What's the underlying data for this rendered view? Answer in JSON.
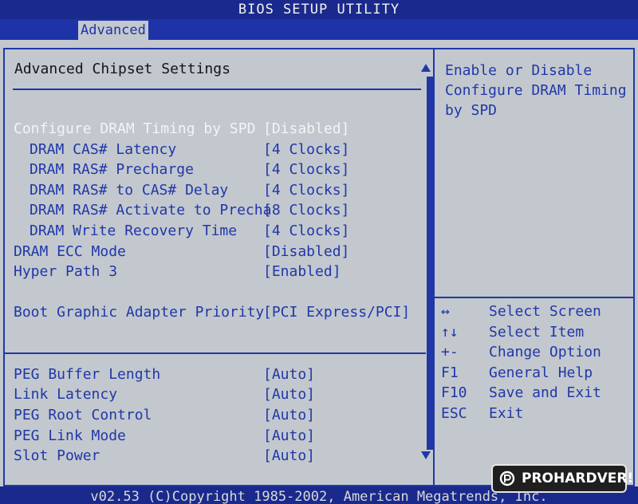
{
  "title": "BIOS SETUP UTILITY",
  "tabs": {
    "active": "Advanced"
  },
  "panel": {
    "title": "Advanced Chipset Settings"
  },
  "settings": [
    {
      "label": "Configure DRAM Timing by SPD",
      "value": "[Disabled]",
      "indent": false,
      "selected": true
    },
    {
      "label": "DRAM CAS# Latency",
      "value": "[4 Clocks]",
      "indent": true
    },
    {
      "label": "DRAM RAS# Precharge",
      "value": "[4 Clocks]",
      "indent": true
    },
    {
      "label": "DRAM RAS# to CAS# Delay",
      "value": "[4 Clocks]",
      "indent": true
    },
    {
      "label": "DRAM RAS# Activate to Precha",
      "value": "[8 Clocks]",
      "indent": true
    },
    {
      "label": "DRAM Write Recovery Time",
      "value": "[4 Clocks]",
      "indent": true
    },
    {
      "label": "DRAM ECC Mode",
      "value": "[Disabled]",
      "indent": false
    },
    {
      "label": "Hyper Path 3",
      "value": "[Enabled]",
      "indent": false
    },
    {
      "label": "Boot Graphic Adapter Priority",
      "value": "[PCI Express/PCI]",
      "indent": false
    },
    {
      "label": "PEG Buffer Length",
      "value": "[Auto]",
      "indent": false
    },
    {
      "label": "Link Latency",
      "value": "[Auto]",
      "indent": false
    },
    {
      "label": "PEG Root Control",
      "value": "[Auto]",
      "indent": false
    },
    {
      "label": "PEG Link Mode",
      "value": "[Auto]",
      "indent": false
    },
    {
      "label": "Slot Power",
      "value": "[Auto]",
      "indent": false
    }
  ],
  "help": {
    "lines": [
      "Enable or Disable",
      "Configure DRAM Timing",
      "by SPD"
    ]
  },
  "keys": [
    {
      "key": "↔",
      "desc": "Select Screen"
    },
    {
      "key": "↑↓",
      "desc": "Select Item"
    },
    {
      "key": "+-",
      "desc": "Change Option"
    },
    {
      "key": "F1",
      "desc": "General Help"
    },
    {
      "key": "F10",
      "desc": "Save and Exit"
    },
    {
      "key": "ESC",
      "desc": "Exit"
    }
  ],
  "footer": "v02.53 (C)Copyright 1985-2002, American Megatrends, Inc.",
  "watermark": "PROHARDVER!",
  "colors": {
    "background": "#c2c8ce",
    "accent": "#2137a8",
    "bar": "#1a2a8c",
    "highlight": "#f4f4f4"
  }
}
